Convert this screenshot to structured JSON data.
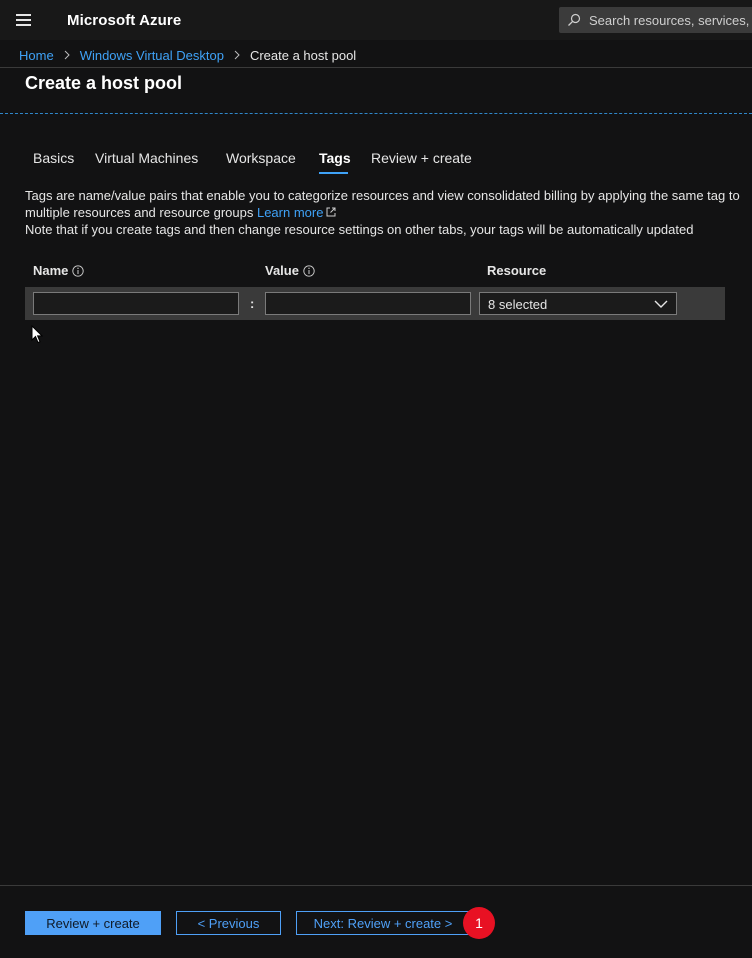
{
  "header": {
    "brand": "Microsoft Azure",
    "search_placeholder": "Search resources, services, and docs"
  },
  "breadcrumb": {
    "items": [
      "Home",
      "Windows Virtual Desktop",
      "Create a host pool"
    ]
  },
  "page": {
    "title": "Create a host pool"
  },
  "tabs": {
    "items": [
      "Basics",
      "Virtual Machines",
      "Workspace",
      "Tags",
      "Review + create"
    ],
    "active": "Tags"
  },
  "description": {
    "line1": "Tags are name/value pairs that enable you to categorize resources and view consolidated billing by applying the same tag to multiple resources and resource groups",
    "learn_more": "Learn more",
    "line2": "Note that if you create tags and then change resource settings on other tabs, your tags will be automatically updated"
  },
  "tags_table": {
    "headers": {
      "name": "Name",
      "value": "Value",
      "resource": "Resource"
    },
    "rows": [
      {
        "name": "",
        "value": "",
        "separator": ":",
        "resource": "8 selected"
      }
    ]
  },
  "footer": {
    "review_create": "Review + create",
    "previous": "< Previous",
    "next": "Next: Review + create >",
    "callout": "1"
  },
  "colors": {
    "accent": "#3fa2f7",
    "callout": "#e81123",
    "background": "#121213"
  }
}
